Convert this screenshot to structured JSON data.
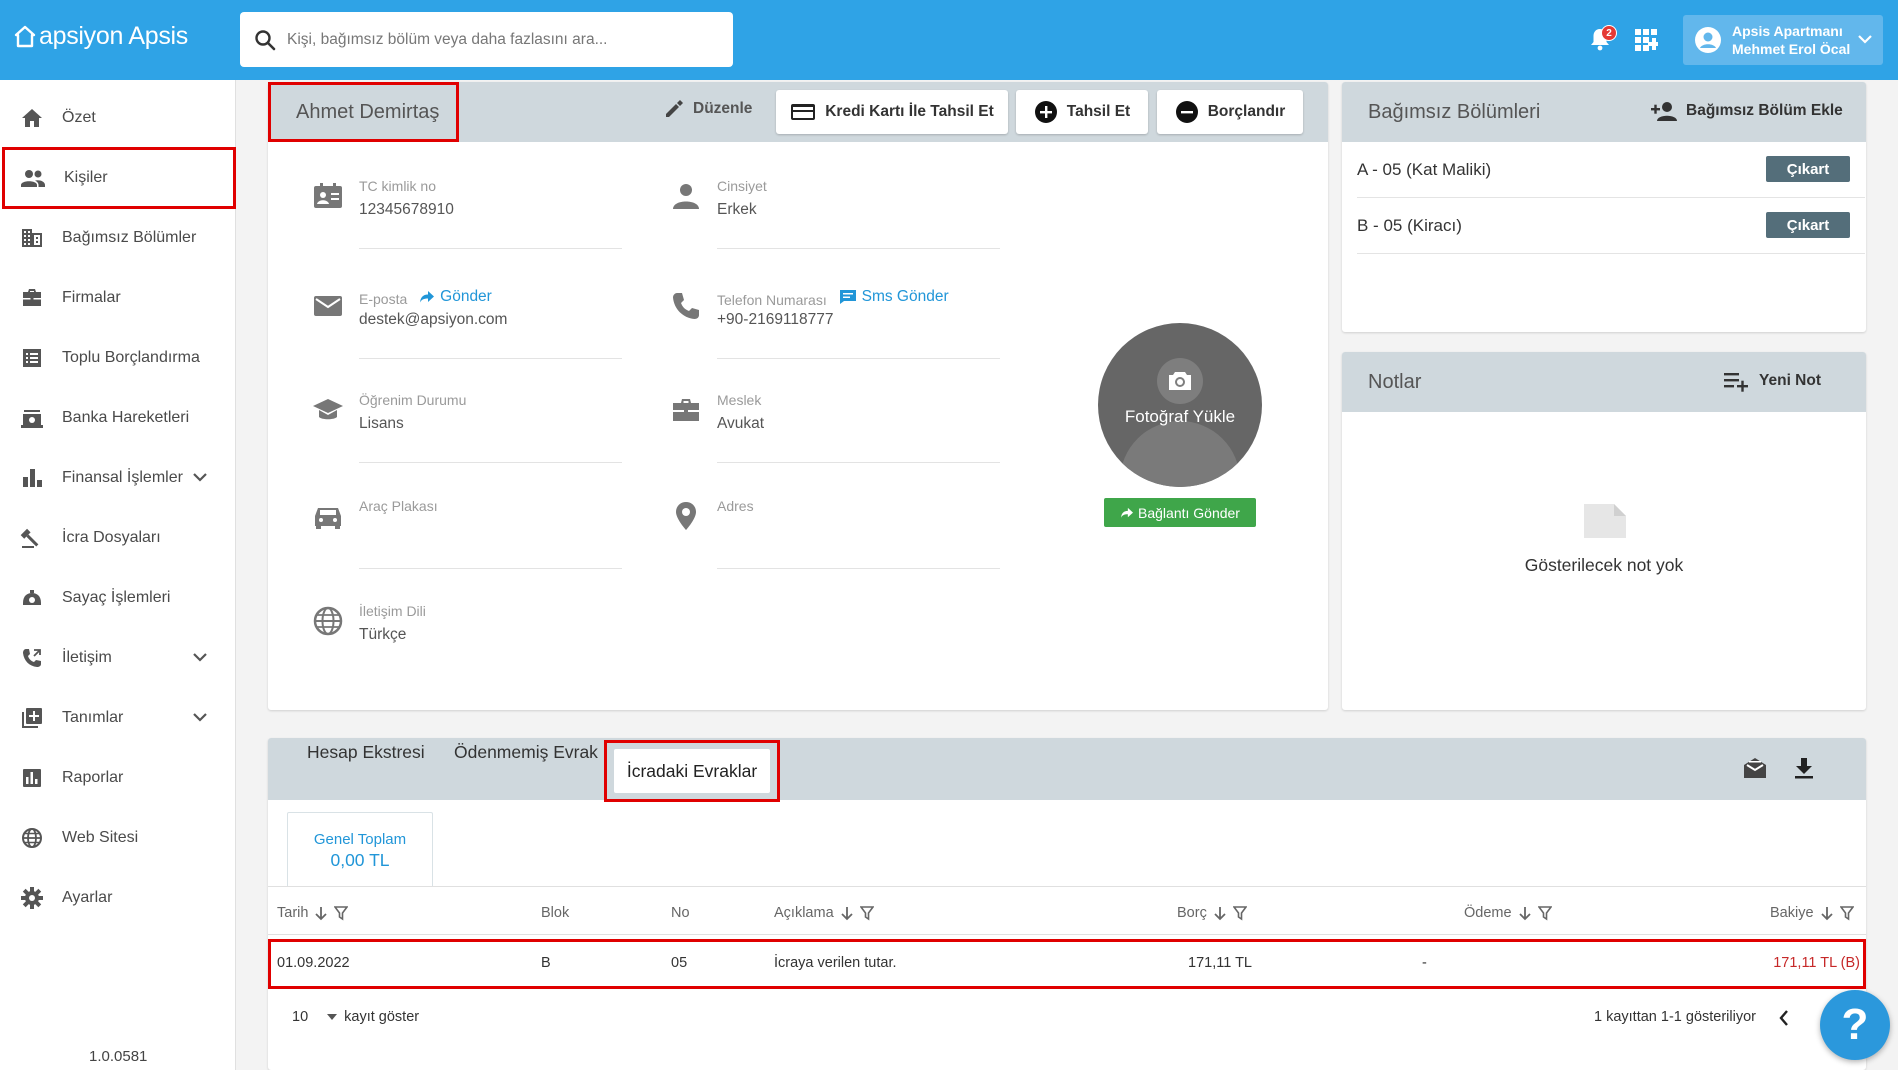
{
  "app": {
    "logo_text": "apsiyon Apsis"
  },
  "search": {
    "placeholder": "Kişi, bağımsız bölüm veya daha fazlasını ara..."
  },
  "header": {
    "notification_count": "2",
    "user_line1": "Apsis Apartmanı",
    "user_line2": "Mehmet Erol Öcal"
  },
  "sidebar": {
    "items": [
      {
        "label": "Özet",
        "icon": "home-icon"
      },
      {
        "label": "Kişiler",
        "icon": "people-icon"
      },
      {
        "label": "Bağımsız Bölümler",
        "icon": "building-icon"
      },
      {
        "label": "Firmalar",
        "icon": "briefcase-icon"
      },
      {
        "label": "Toplu Borçlandırma",
        "icon": "list-icon"
      },
      {
        "label": "Banka Hareketleri",
        "icon": "bank-icon"
      },
      {
        "label": "Finansal İşlemler",
        "icon": "bar-chart-icon"
      },
      {
        "label": "İcra Dosyaları",
        "icon": "gavel-icon"
      },
      {
        "label": "Sayaç İşlemleri",
        "icon": "meter-icon"
      },
      {
        "label": "İletişim",
        "icon": "phone-icon"
      },
      {
        "label": "Tanımlar",
        "icon": "add-box-icon"
      },
      {
        "label": "Raporlar",
        "icon": "report-icon"
      },
      {
        "label": "Web Sitesi",
        "icon": "globe-icon"
      },
      {
        "label": "Ayarlar",
        "icon": "gear-icon"
      }
    ],
    "version": "1.0.0581"
  },
  "person": {
    "name": "Ahmet Demirtaş",
    "actions": {
      "edit": "Düzenle",
      "credit_card": "Kredi Kartı İle Tahsil Et",
      "collect": "Tahsil Et",
      "debit": "Borçlandır"
    },
    "fields": {
      "tc_label": "TC kimlik no",
      "tc_value": "12345678910",
      "gender_label": "Cinsiyet",
      "gender_value": "Erkek",
      "email_label": "E-posta",
      "email_action": "Gönder",
      "email_value": "destek@apsiyon.com",
      "phone_label": "Telefon Numarası",
      "phone_action": "Sms Gönder",
      "phone_value": "+90-2169118777",
      "education_label": "Öğrenim Durumu",
      "education_value": "Lisans",
      "job_label": "Meslek",
      "job_value": "Avukat",
      "plate_label": "Araç Plakası",
      "plate_value": "",
      "address_label": "Adres",
      "address_value": "",
      "language_label": "İletişim Dili",
      "language_value": "Türkçe"
    },
    "photo_text": "Fotoğraf Yükle",
    "send_link": "Bağlantı Gönder"
  },
  "units": {
    "title": "Bağımsız Bölümleri",
    "add_label": "Bağımsız Bölüm Ekle",
    "rows": [
      {
        "label": "A - 05 (Kat Maliki)",
        "action": "Çıkart"
      },
      {
        "label": "B - 05 (Kiracı)",
        "action": "Çıkart"
      }
    ]
  },
  "notes": {
    "title": "Notlar",
    "new_label": "Yeni Not",
    "empty_text": "Gösterilecek not yok"
  },
  "ledger": {
    "tabs": [
      "Hesap Ekstresi",
      "Ödenmemiş Evrak",
      "İcradaki Evraklar"
    ],
    "active_tab": "İcradaki Evraklar",
    "total_label": "Genel Toplam",
    "total_value": "0,00 TL",
    "columns": {
      "date": "Tarih",
      "block": "Blok",
      "no": "No",
      "description": "Açıklama",
      "debt": "Borç",
      "payment": "Ödeme",
      "balance": "Bakiye"
    },
    "rows": [
      {
        "date": "01.09.2022",
        "block": "B",
        "no": "05",
        "description": "İcraya verilen tutar.",
        "debt": "171,11 TL",
        "payment": "-",
        "balance": "171,11 TL (B)"
      }
    ],
    "page_size": "10",
    "page_size_label": "kayıt göster",
    "pagination_info": "1 kayıttan 1-1 gösteriliyor"
  },
  "colors": {
    "primary": "#2fa3e6",
    "danger": "#c62828",
    "success": "#3fa64a",
    "highlight": "#e00000"
  }
}
